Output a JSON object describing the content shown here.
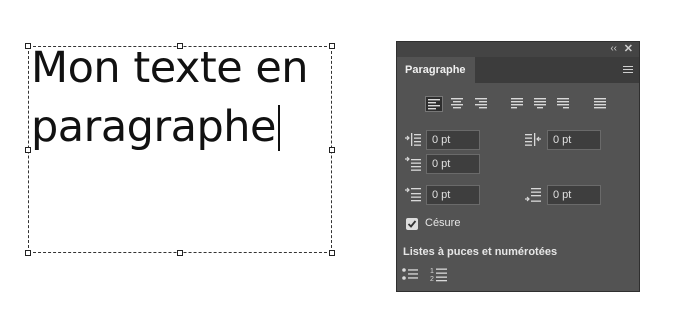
{
  "canvas": {
    "lines": [
      "Mon texte en",
      "paragraphe"
    ]
  },
  "panel": {
    "title": "Paragraphe",
    "collapse_glyph": "‹‹",
    "close_glyph": "✕",
    "indent_left": "0 pt",
    "indent_right": "0 pt",
    "indent_first_line": "0 pt",
    "space_before": "0 pt",
    "space_after": "0 pt",
    "hyphenation_label": "Césure",
    "hyphenation_checked": true,
    "lists_title": "Listes à puces et numérotées",
    "active_alignment": "align-left"
  },
  "colors": {
    "panel_bg": "#535353",
    "panel_dark": "#3c3c3c",
    "field_bg": "#3e3e3e",
    "icon": "#d9d9d9"
  }
}
